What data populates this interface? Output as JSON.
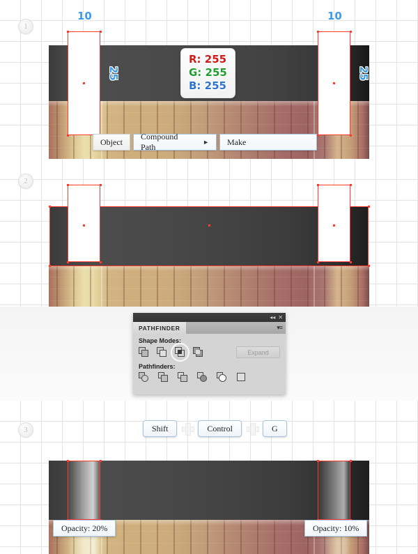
{
  "steps": [
    {
      "number": "1"
    },
    {
      "number": "2"
    },
    {
      "number": "3"
    }
  ],
  "step1": {
    "measure_left_width": "10",
    "measure_right_width": "10",
    "measure_left_height": "25",
    "measure_right_height": "25",
    "color_tooltip": {
      "r": "R: 255",
      "g": "G: 255",
      "b": "B: 255",
      "r_color": "#d01b1b",
      "g_color": "#1f9e2e",
      "b_color": "#2f74d0"
    },
    "menu": {
      "item1": "Object",
      "item2": "Compound Path",
      "item2_arrow": "►",
      "item3": "Make"
    }
  },
  "pathfinder": {
    "collapse_icon": "◂◂",
    "close_icon": "✕",
    "tab_title": "PATHFINDER",
    "menu_icon": "▾≡",
    "shape_modes_label": "Shape Modes:",
    "pathfinders_label": "Pathfinders:",
    "expand_label": "Expand",
    "shape_mode_icons": [
      "unite-icon",
      "minus-front-icon",
      "intersect-icon",
      "exclude-icon"
    ],
    "active_shape_mode": "intersect-icon",
    "pathfinder_icons": [
      "divide-icon",
      "trim-icon",
      "merge-icon",
      "crop-icon",
      "outline-icon",
      "minus-back-icon"
    ]
  },
  "step3": {
    "keys": {
      "key1": "Shift",
      "plus1": "plus-icon",
      "key2": "Control",
      "plus2": "plus-icon",
      "key3": "G"
    },
    "opacity_left": "Opacity: 20%",
    "opacity_right": "Opacity: 10%"
  },
  "colors": {
    "grid_line": "#e3e3e3",
    "selection": "#ff3b30",
    "measure_text": "#3d9be9",
    "canvas_bg": "#ffffff"
  }
}
